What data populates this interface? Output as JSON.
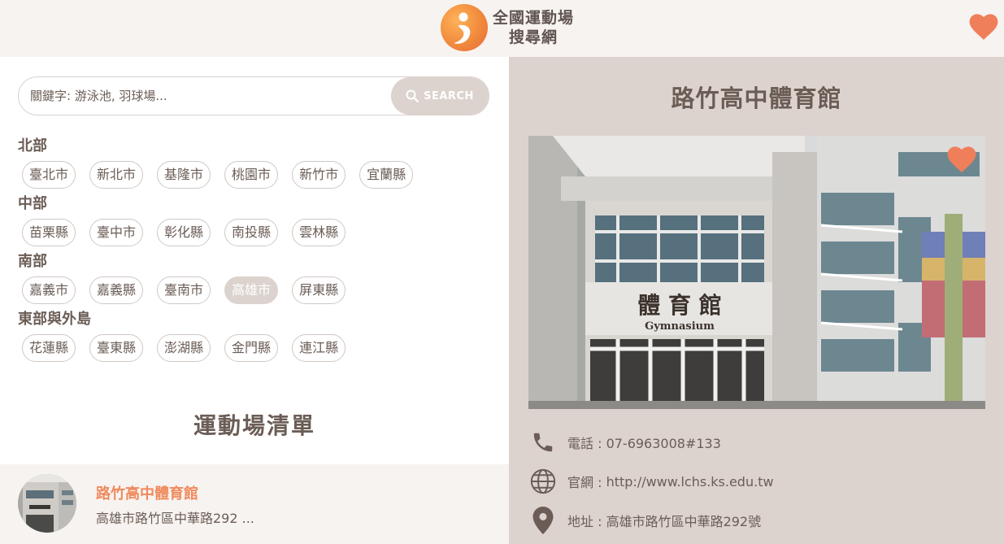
{
  "header": {
    "logo_line1": "全國運動場",
    "logo_line2": "搜尋網",
    "favorites_icon": "heart-icon",
    "accent": "#ef7f5a"
  },
  "search": {
    "placeholder": "關鍵字: 游泳池, 羽球場...",
    "button_label": "SEARCH",
    "button_icon": "search-icon"
  },
  "regions": [
    {
      "title": "北部",
      "cities": [
        "臺北市",
        "新北市",
        "基隆市",
        "桃園市",
        "新竹市",
        "宜蘭縣"
      ]
    },
    {
      "title": "中部",
      "cities": [
        "苗栗縣",
        "臺中市",
        "彰化縣",
        "南投縣",
        "雲林縣"
      ]
    },
    {
      "title": "南部",
      "cities": [
        "嘉義市",
        "嘉義縣",
        "臺南市",
        "高雄市",
        "屏東縣"
      ]
    },
    {
      "title": "東部與外島",
      "cities": [
        "花蓮縣",
        "臺東縣",
        "澎湖縣",
        "金門縣",
        "連江縣"
      ]
    }
  ],
  "selected_city": "高雄市",
  "list": {
    "title": "運動場清單",
    "items": [
      {
        "name": "路竹高中體育館",
        "address": "高雄市路竹區中華路292 ..."
      }
    ]
  },
  "detail": {
    "title": "路竹高中體育館",
    "photo_sign_cn": "體 育 館",
    "photo_sign_en": "Gymnasium",
    "phone_label": "電話 : 07-6963008#133",
    "website_prefix": "官網 : ",
    "website": "http://www.lchs.ks.edu.tw",
    "address_label": "地址 : 高雄市路竹區中華路292號",
    "icons": [
      "phone-icon",
      "globe-icon",
      "map-pin-icon"
    ]
  }
}
